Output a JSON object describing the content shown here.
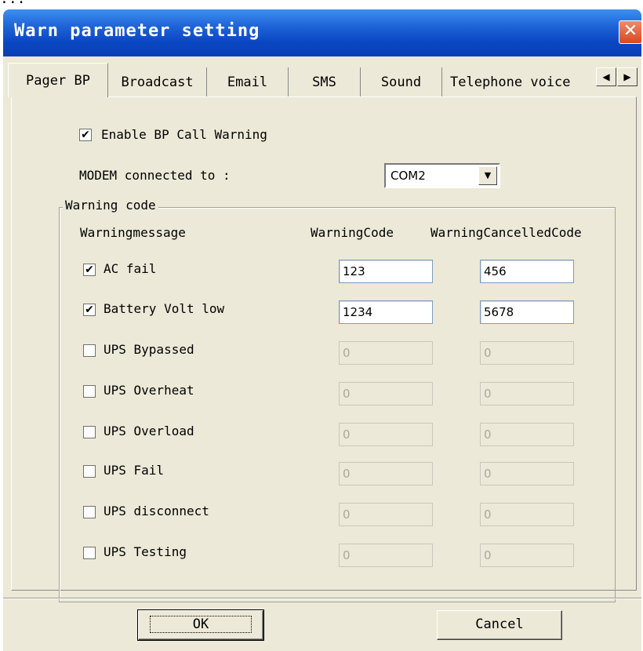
{
  "window": {
    "top_strip_text": "...",
    "title": "Warn parameter setting",
    "close_glyph": "✕"
  },
  "tabs": [
    {
      "label": "Pager BP",
      "active": true
    },
    {
      "label": "Broadcast",
      "active": false
    },
    {
      "label": "Email",
      "active": false
    },
    {
      "label": "SMS",
      "active": false
    },
    {
      "label": "Sound",
      "active": false
    },
    {
      "label": "Telephone voice",
      "active": false
    }
  ],
  "tab_scroll": {
    "left": "◀",
    "right": "▶"
  },
  "enable": {
    "checked": true,
    "label": "Enable BP Call Warning"
  },
  "modem": {
    "label": "MODEM connected to :",
    "value": "COM2",
    "arrow": "▼"
  },
  "group": {
    "legend": "Warning code",
    "col_message": "Warningmessage",
    "col_code": "WarningCode",
    "col_cancel": "WarningCancelledCode",
    "rows": [
      {
        "checked": true,
        "label": "AC fail",
        "code": "123",
        "cancel": "456"
      },
      {
        "checked": true,
        "label": "Battery Volt low",
        "code": "1234",
        "cancel": "5678"
      },
      {
        "checked": false,
        "label": "UPS Bypassed",
        "code": "0",
        "cancel": "0"
      },
      {
        "checked": false,
        "label": "UPS Overheat",
        "code": "0",
        "cancel": "0"
      },
      {
        "checked": false,
        "label": "UPS Overload",
        "code": "0",
        "cancel": "0"
      },
      {
        "checked": false,
        "label": "UPS Fail",
        "code": "0",
        "cancel": "0"
      },
      {
        "checked": false,
        "label": "UPS disconnect",
        "code": "0",
        "cancel": "0"
      },
      {
        "checked": false,
        "label": "UPS Testing",
        "code": "0",
        "cancel": "0"
      }
    ]
  },
  "buttons": {
    "ok": "OK",
    "cancel": "Cancel"
  },
  "check_glyph": "✔"
}
